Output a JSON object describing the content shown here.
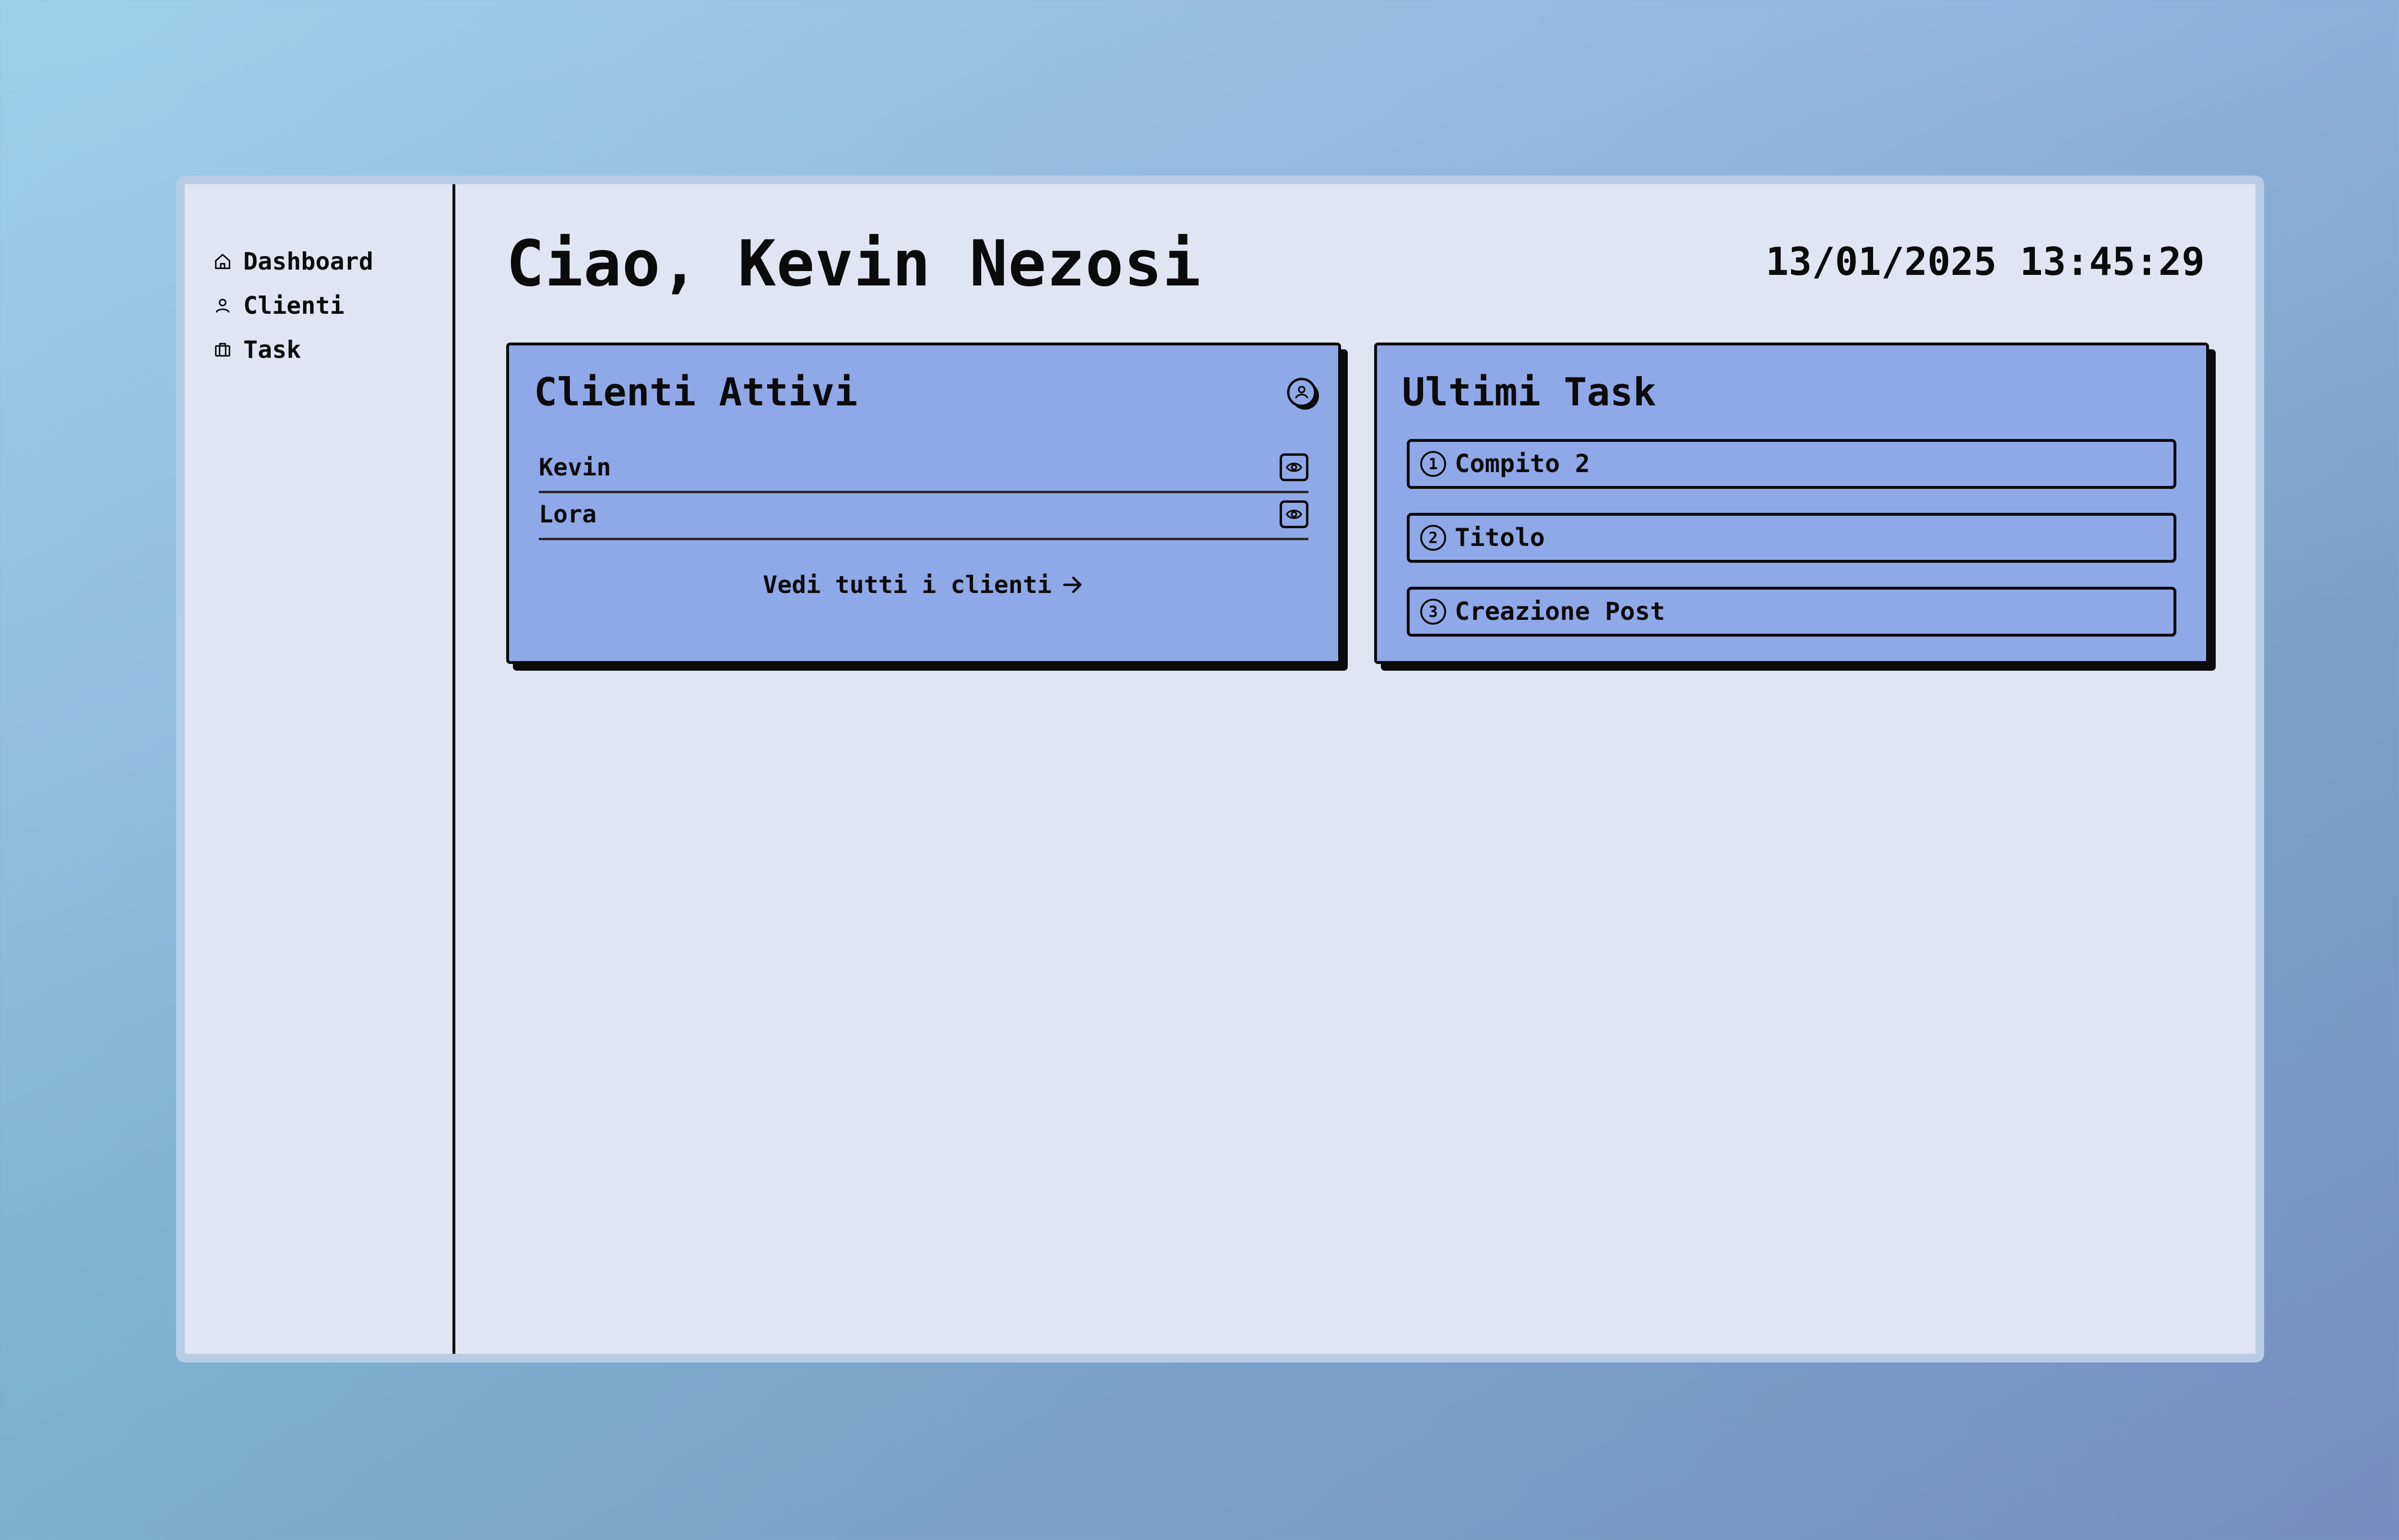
{
  "sidebar": {
    "items": [
      {
        "label": "Dashboard",
        "icon": "home-icon"
      },
      {
        "label": "Clienti",
        "icon": "user-icon"
      },
      {
        "label": "Task",
        "icon": "briefcase-icon"
      }
    ]
  },
  "header": {
    "greeting": "Ciao, Kevin Nezosi",
    "datetime": "13/01/2025 13:45:29"
  },
  "clients_card": {
    "title": "Clienti Attivi",
    "icon": "user-circle-icon",
    "clients": [
      {
        "name": "Kevin",
        "action_icon": "eye-icon"
      },
      {
        "name": "Lora",
        "action_icon": "eye-icon"
      }
    ],
    "see_all_label": "Vedi tutti i clienti",
    "see_all_icon": "arrow-right-icon"
  },
  "tasks_card": {
    "title": "Ultimi Task",
    "tasks": [
      {
        "number": "1",
        "label": "Compito 2"
      },
      {
        "number": "2",
        "label": "Titolo"
      },
      {
        "number": "3",
        "label": "Creazione Post"
      }
    ]
  },
  "colors": {
    "background_top": "#9fcfe6",
    "background_bottom": "#6a82b4",
    "window_frame": "#b8cce6",
    "panel": "#e1e5f2",
    "card": "#8fa8e8",
    "ink": "#0b0b0b"
  }
}
